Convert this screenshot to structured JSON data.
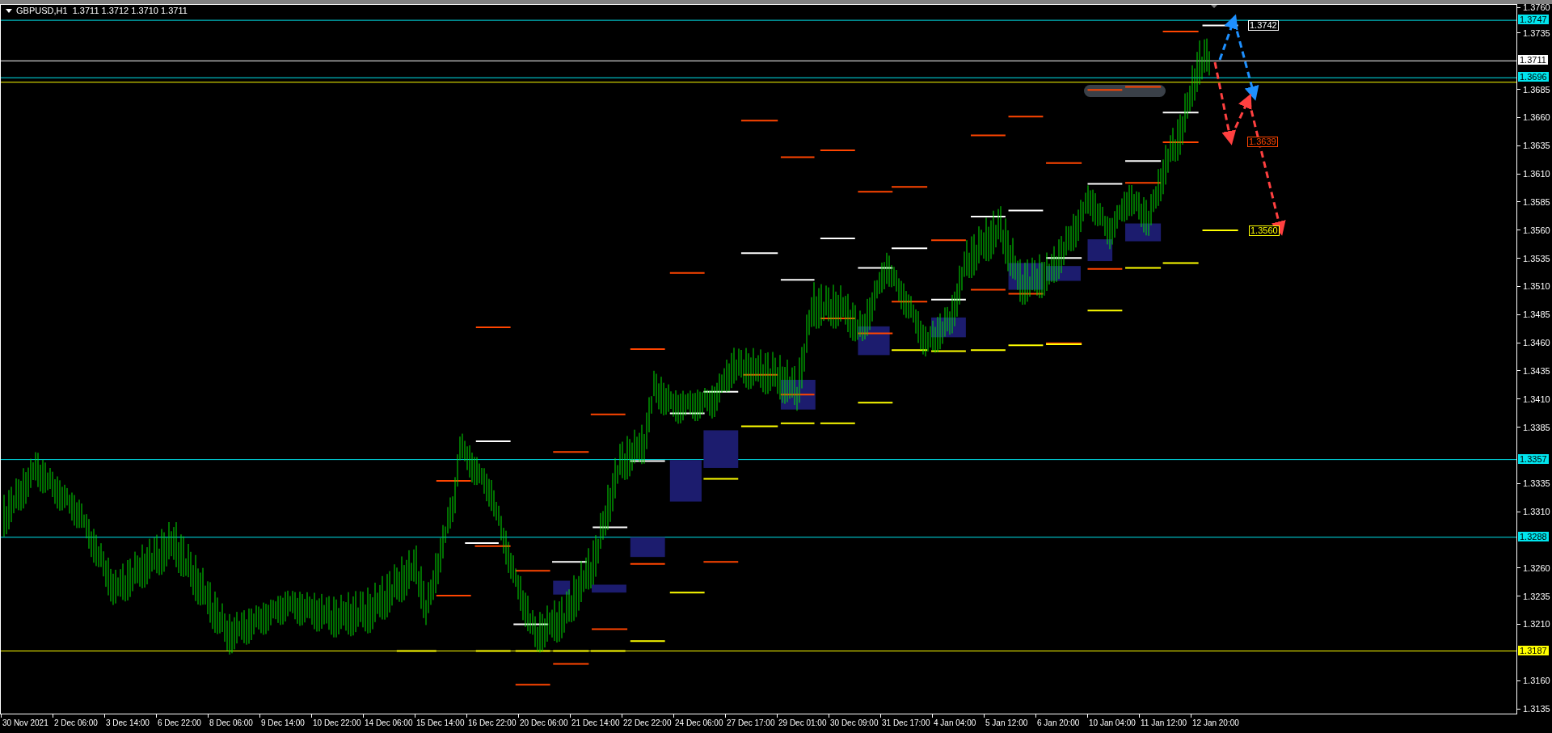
{
  "chart_header": {
    "title": "GBPUSD,H1  1.3711 1.3712 1.3710 1.3711"
  },
  "horizontal_lines": [
    {
      "label": "1.3747",
      "color": "#00e5ee"
    },
    {
      "label": "1.3711",
      "color": "#ffffff"
    },
    {
      "label": "1.3696",
      "color": "#00e5ee"
    },
    {
      "label": "1.3357",
      "color": "#00e5ee"
    },
    {
      "label": "1.3288",
      "color": "#00e5ee"
    },
    {
      "label": "1.3187",
      "color": "#ffff00"
    }
  ],
  "chart_tags": [
    {
      "label": "1.3742",
      "color": "#ffffff"
    },
    {
      "label": "1.3639",
      "color": "#ff4500"
    },
    {
      "label": "1.3560",
      "color": "#ffff00"
    }
  ],
  "price_axis": [
    "1.3760",
    "1.3735",
    "1.3685",
    "1.3660",
    "1.3635",
    "1.3610",
    "1.3585",
    "1.3560",
    "1.3535",
    "1.3510",
    "1.3485",
    "1.3460",
    "1.3435",
    "1.3410",
    "1.3385",
    "1.3335",
    "1.3310",
    "1.3260",
    "1.3235",
    "1.3210",
    "1.3160",
    "1.3135"
  ],
  "time_axis": [
    "30 Nov 2021",
    "2 Dec 06:00",
    "3 Dec 14:00",
    "6 Dec 22:00",
    "8 Dec 06:00",
    "9 Dec 14:00",
    "10 Dec 22:00",
    "14 Dec 06:00",
    "15 Dec 14:00",
    "16 Dec 22:00",
    "20 Dec 06:00",
    "21 Dec 14:00",
    "22 Dec 22:00",
    "24 Dec 06:00",
    "27 Dec 17:00",
    "29 Dec 01:00",
    "30 Dec 09:00",
    "31 Dec 17:00",
    "4 Jan 04:00",
    "5 Jan 12:00",
    "6 Jan 20:00",
    "10 Jan 04:00",
    "11 Jan 12:00",
    "12 Jan 20:00"
  ]
}
